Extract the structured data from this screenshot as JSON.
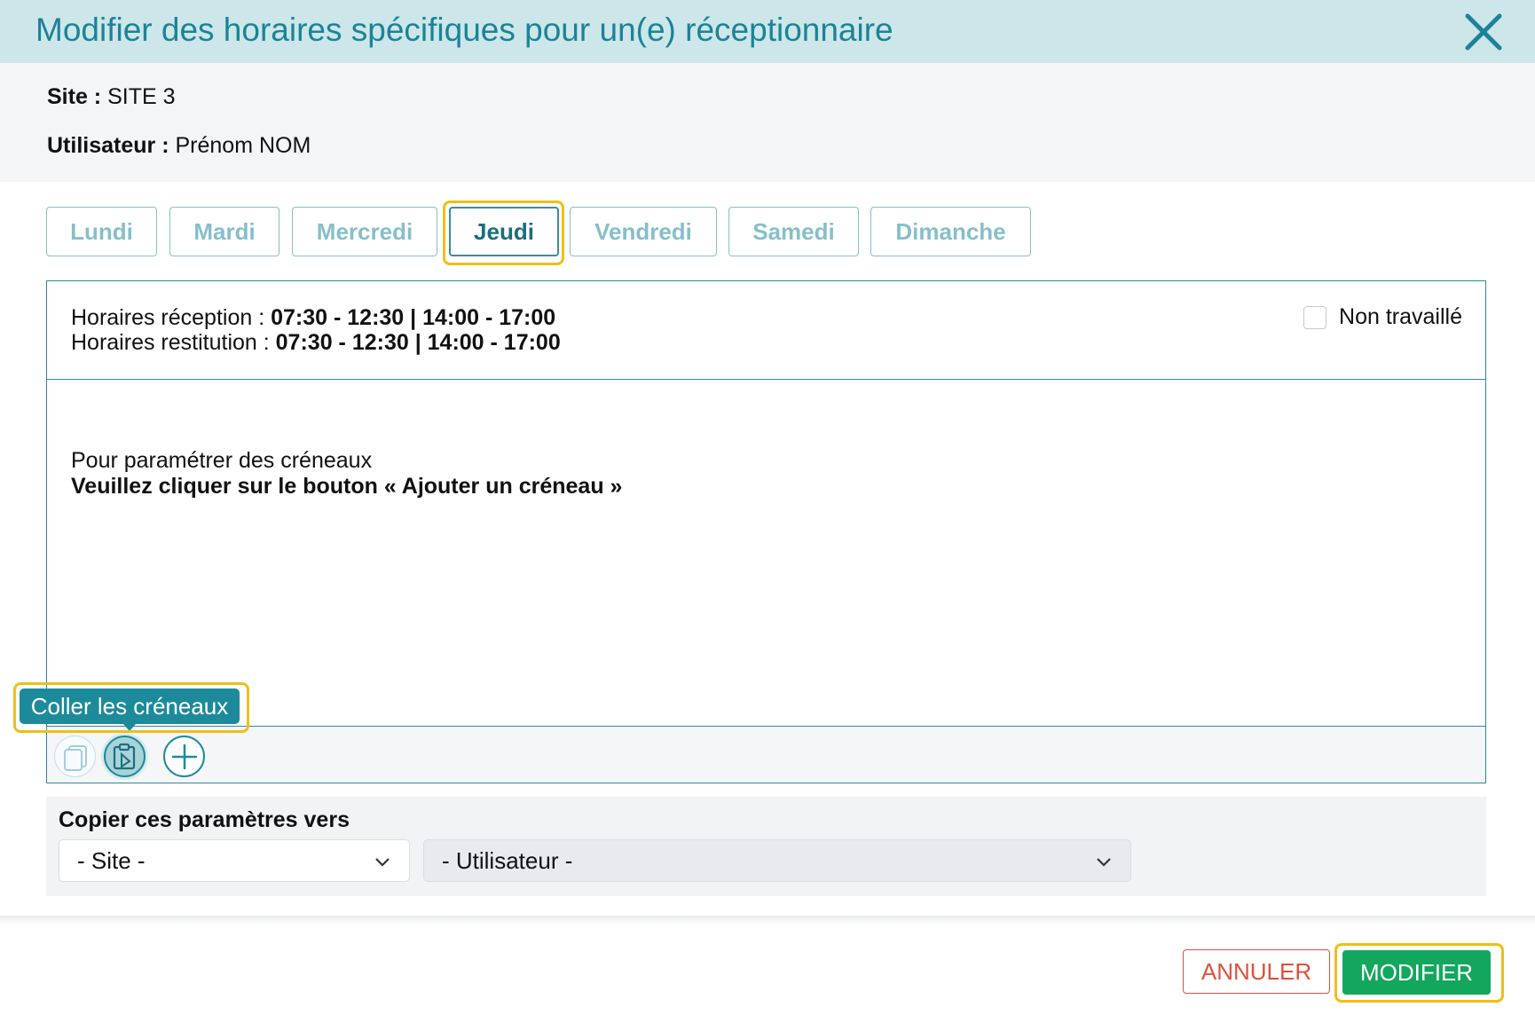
{
  "dialog": {
    "title": "Modifier des horaires spécifiques pour un(e) réceptionnaire",
    "close_icon": "close-icon"
  },
  "info": {
    "site_label": "Site :",
    "site_value": "SITE 3",
    "user_label": "Utilisateur :",
    "user_value": "Prénom NOM"
  },
  "tabs": [
    {
      "label": "Lundi",
      "active": false
    },
    {
      "label": "Mardi",
      "active": false
    },
    {
      "label": "Mercredi",
      "active": false
    },
    {
      "label": "Jeudi",
      "active": true
    },
    {
      "label": "Vendredi",
      "active": false
    },
    {
      "label": "Samedi",
      "active": false
    },
    {
      "label": "Dimanche",
      "active": false
    }
  ],
  "hours": {
    "reception_label": "Horaires réception :",
    "reception_value": "07:30 - 12:30 | 14:00 - 17:00",
    "restitution_label": "Horaires restitution :",
    "restitution_value": "07:30 - 12:30 | 14:00 - 17:00",
    "not_worked_label": "Non travaillé",
    "not_worked_checked": false
  },
  "empty_state": {
    "line1": "Pour paramétrer des créneaux",
    "line2": "Veuillez cliquer sur le bouton « Ajouter un créneau »"
  },
  "toolbar": {
    "tooltip": "Coller les créneaux",
    "buttons": [
      "copy-icon",
      "paste-icon",
      "plus-icon"
    ]
  },
  "copy_section": {
    "label": "Copier ces paramètres vers",
    "site_select": "- Site -",
    "user_select": "- Utilisateur -"
  },
  "footer": {
    "cancel_label": "ANNULER",
    "submit_label": "MODIFIER"
  },
  "colors": {
    "accent": "#1a8496",
    "header_bg": "#cde6ea",
    "highlight": "#f0be1a",
    "cancel": "#e0503c",
    "submit": "#13a75e"
  }
}
